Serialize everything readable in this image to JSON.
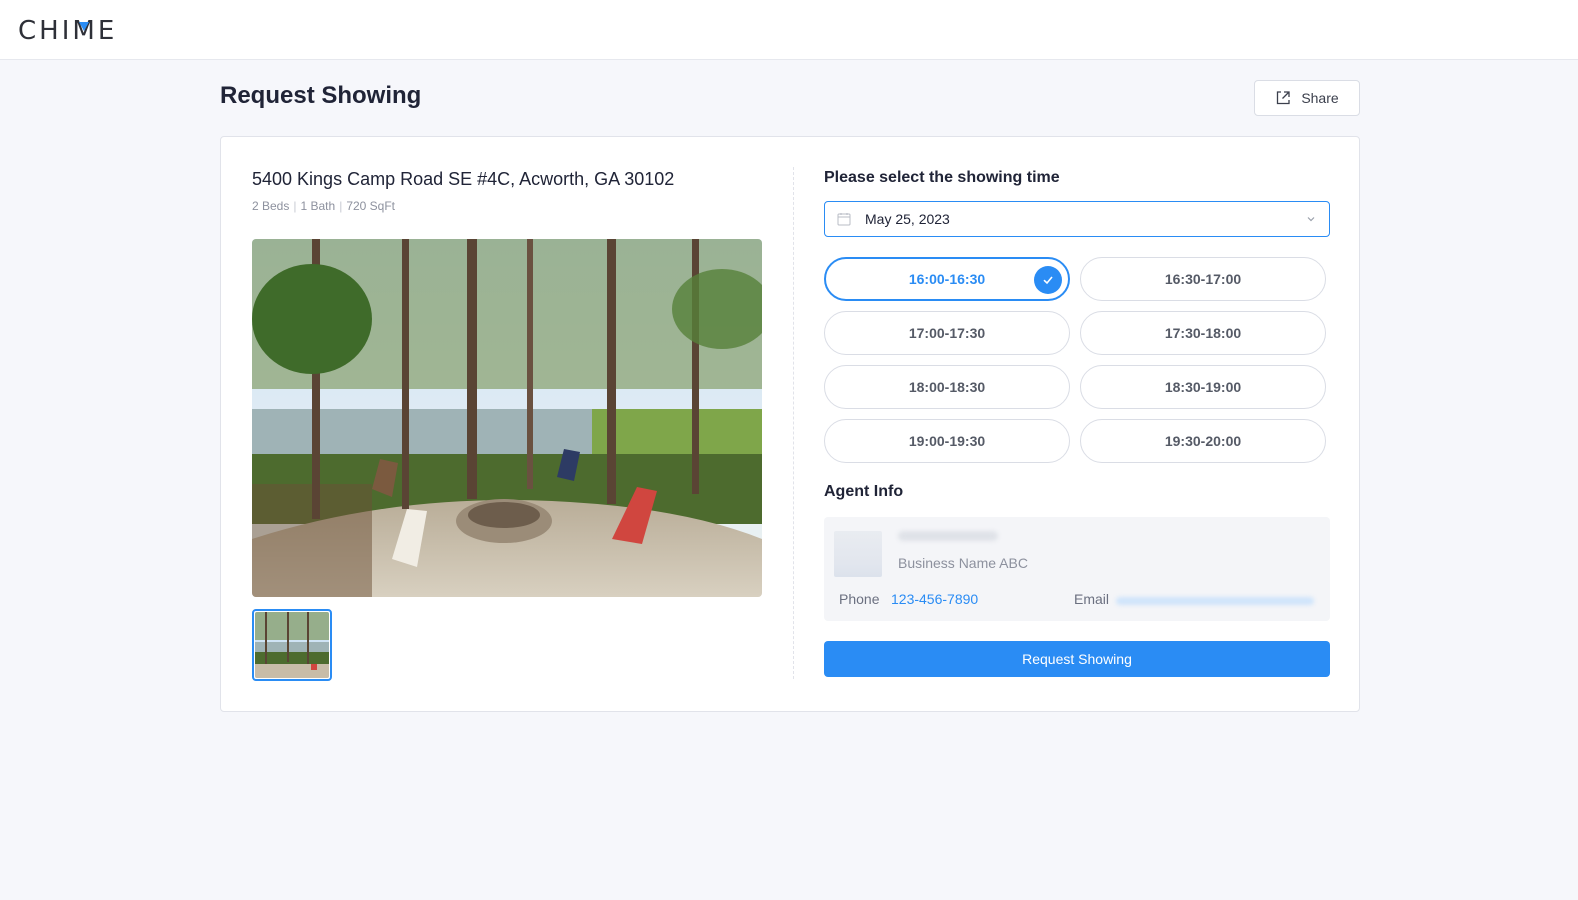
{
  "header": {
    "logo_text": "CHIME"
  },
  "page": {
    "title": "Request Showing",
    "share_label": "Share"
  },
  "listing": {
    "address": "5400 Kings Camp Road SE #4C, Acworth, GA 30102",
    "beds": "2 Beds",
    "baths": "1 Bath",
    "sqft": "720 SqFt"
  },
  "showing": {
    "prompt": "Please select the showing time",
    "date": "May 25, 2023",
    "slots": [
      {
        "label": "16:00-16:30",
        "selected": true
      },
      {
        "label": "16:30-17:00",
        "selected": false
      },
      {
        "label": "17:00-17:30",
        "selected": false
      },
      {
        "label": "17:30-18:00",
        "selected": false
      },
      {
        "label": "18:00-18:30",
        "selected": false
      },
      {
        "label": "18:30-19:00",
        "selected": false
      },
      {
        "label": "19:00-19:30",
        "selected": false
      },
      {
        "label": "19:30-20:00",
        "selected": false
      }
    ]
  },
  "agent": {
    "title": "Agent Info",
    "business": "Business Name ABC",
    "phone_label": "Phone",
    "phone": "123-456-7890",
    "email_label": "Email"
  },
  "actions": {
    "request_label": "Request Showing"
  },
  "colors": {
    "accent": "#2a8cf4",
    "text": "#202437",
    "muted": "#8d919e"
  },
  "icons": [
    "share-icon",
    "calendar-icon",
    "chevron-down-icon",
    "check-icon"
  ]
}
